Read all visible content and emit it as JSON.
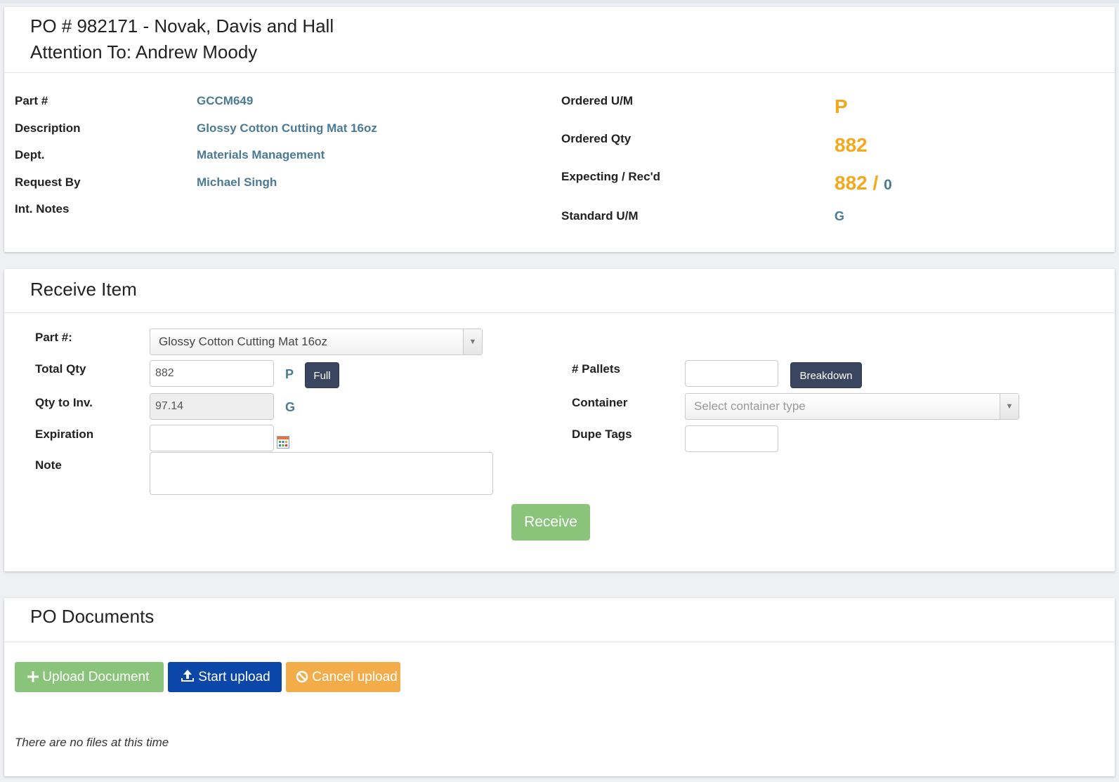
{
  "po_header": {
    "po_line": "PO # 982171 - Novak, Davis and Hall",
    "attention_line": "Attention To: Andrew Moody"
  },
  "item_details": {
    "part_label": "Part #",
    "part_value": "GCCM649",
    "description_label": "Description",
    "description_value": "Glossy Cotton Cutting Mat 16oz",
    "dept_label": "Dept.",
    "dept_value": "Materials Management",
    "request_by_label": "Request By",
    "request_by_value": "Michael Singh",
    "int_notes_label": "Int. Notes",
    "ordered_um_label": "Ordered U/M",
    "ordered_um_value": "P",
    "ordered_qty_label": "Ordered Qty",
    "ordered_qty_value": "882",
    "expecting_label": "Expecting / Rec'd",
    "expecting_value": "882",
    "expecting_sep": "/",
    "received_value": "0",
    "standard_um_label": "Standard U/M",
    "standard_um_value": "G"
  },
  "receive_item": {
    "title": "Receive Item",
    "part_label": "Part #:",
    "part_selected": "Glossy Cotton Cutting Mat 16oz",
    "total_qty_label": "Total Qty",
    "total_qty_value": "882",
    "total_qty_unit": "P",
    "full_button": "Full",
    "qty_inv_label": "Qty to Inv.",
    "qty_inv_value": "97.14",
    "qty_inv_unit": "G",
    "expiration_label": "Expiration",
    "expiration_value": "",
    "note_label": "Note",
    "note_value": "",
    "pallets_label": "# Pallets",
    "pallets_value": "",
    "breakdown_button": "Breakdown",
    "container_label": "Container",
    "container_placeholder": "Select container type",
    "dupe_tags_label": "Dupe Tags",
    "dupe_tags_value": "",
    "receive_button": "Receive"
  },
  "po_documents": {
    "title": "PO Documents",
    "upload_button": "Upload Document",
    "start_button": "Start upload",
    "cancel_button": "Cancel upload",
    "empty_message": "There are no files at this time"
  },
  "colors": {
    "accent_orange": "#f4a81d",
    "value_blue": "#4a7a94",
    "dark_button": "#3a4660",
    "green_button": "#8ac47b",
    "blue_button": "#0b47a8",
    "orange_button": "#f3ac4a"
  },
  "icons": {
    "select_arrow": "caret-down-icon",
    "calendar": "calendar-icon",
    "plus": "plus-icon",
    "upload": "upload-icon",
    "cancel": "ban-icon"
  }
}
